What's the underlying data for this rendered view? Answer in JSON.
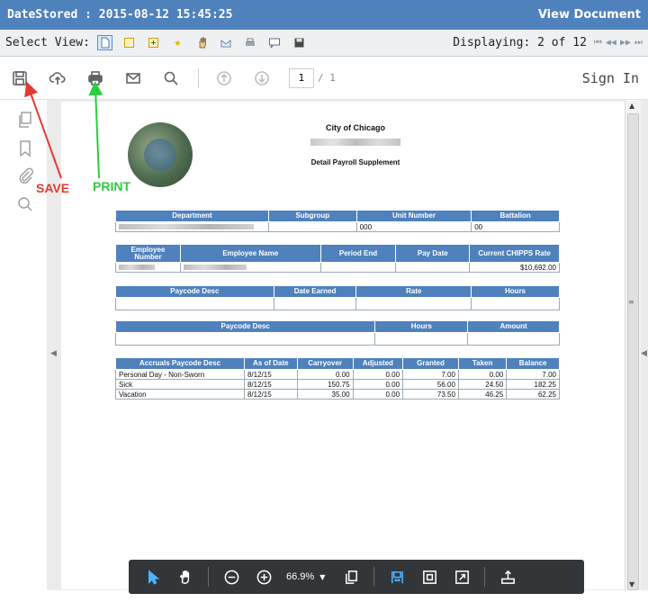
{
  "titlebar": {
    "left": "DateStored : 2015-08-12 15:45:25",
    "right": "View Document"
  },
  "viewbar": {
    "label": "Select View:",
    "displaying": "Displaying: 2 of 12"
  },
  "pdf_toolbar": {
    "page_current": "1",
    "page_total": "/ 1",
    "sign_in": "Sign In"
  },
  "annotations": {
    "save": "SAVE",
    "print": "PRINT"
  },
  "doc": {
    "org": "City of Chicago",
    "title": "Detail Payroll Supplement",
    "dept_table": {
      "headers": [
        "Department",
        "Subgroup",
        "Unit Number",
        "Battalion"
      ],
      "row": [
        "",
        "000",
        "",
        "00"
      ]
    },
    "emp_table": {
      "headers": [
        "Employee Number",
        "Employee Name",
        "Period End",
        "Pay Date",
        "Current CHIPPS Rate"
      ],
      "row": [
        "",
        "",
        "",
        "",
        "$10,692.00"
      ]
    },
    "paycode1_table": {
      "headers": [
        "Paycode Desc",
        "Date Earned",
        "Rate",
        "Hours"
      ]
    },
    "paycode2_table": {
      "headers": [
        "Paycode Desc",
        "Hours",
        "Amount"
      ]
    },
    "accruals_table": {
      "headers": [
        "Accruals Paycode Desc",
        "As of Date",
        "Carryover",
        "Adjusted",
        "Granted",
        "Taken",
        "Balance"
      ],
      "rows": [
        [
          "Personal Day - Non-Sworn",
          "8/12/15",
          "0.00",
          "0.00",
          "7.00",
          "0.00",
          "7.00"
        ],
        [
          "Sick",
          "8/12/15",
          "150.75",
          "0.00",
          "56.00",
          "24.50",
          "182.25"
        ],
        [
          "Vacation",
          "8/12/15",
          "35.00",
          "0.00",
          "73.50",
          "46.25",
          "62.25"
        ]
      ]
    }
  },
  "bottom_toolbar": {
    "zoom": "66.9%"
  },
  "colors": {
    "header_blue": "#4f81bd",
    "save_red": "#e53935",
    "print_green": "#2ecc40"
  }
}
